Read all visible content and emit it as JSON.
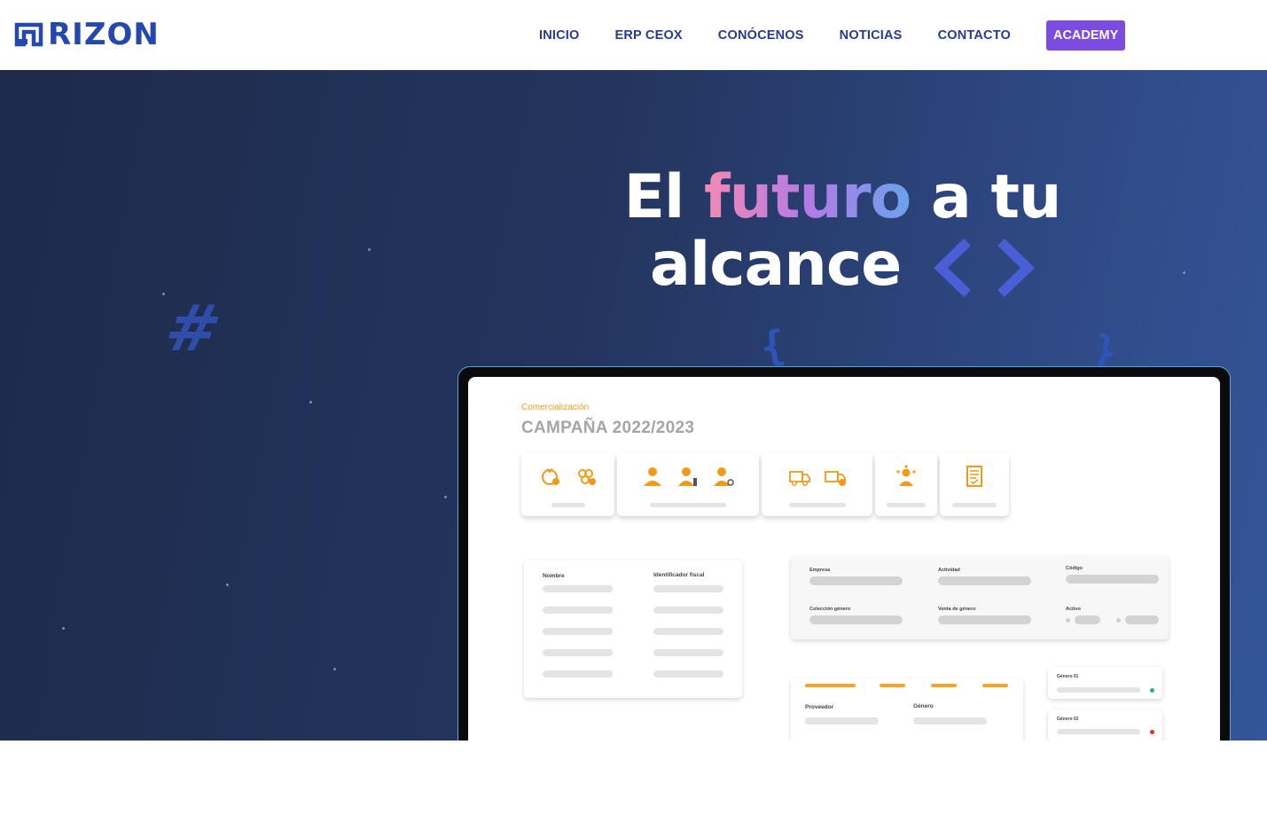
{
  "brand": {
    "name": "RIZON",
    "color": "#2448b0"
  },
  "nav": {
    "items": [
      "INICIO",
      "ERP CEOX",
      "CONÓCENOS",
      "NOTICIAS",
      "CONTACTO"
    ],
    "cta": "ACADEMY",
    "cta_color": "#7c4be0"
  },
  "hero": {
    "headline_1": "El",
    "headline_highlight": "futuro",
    "headline_2": "a tu",
    "headline_3": "alcance",
    "decor": {
      "hash": "#",
      "brace_left": "{",
      "brace_right": "}"
    }
  },
  "screen": {
    "subtitle": "Comercialización",
    "title": "CAMPAÑA 2022/2023",
    "icons": [
      "crop-tomato-icon",
      "crop-grape-icon",
      "user-icon",
      "user-edit-icon",
      "user-search-icon",
      "truck-icon",
      "truck-clock-icon",
      "group-icon",
      "document-icon"
    ],
    "list_panel": {
      "col1": "Nombre",
      "col2": "Identificador fiscal"
    },
    "form_panel": {
      "labels": [
        "Empresa",
        "Actividad",
        "Código",
        "Colección género",
        "Venta de género",
        "Activo"
      ]
    },
    "bottom_panel": {
      "col1": "Proveedor",
      "col2": "Género"
    },
    "cards": [
      {
        "label": "Género 01",
        "status_color": "#2fb36d"
      },
      {
        "label": "Género 02",
        "status_color": "#e0302d"
      }
    ]
  }
}
